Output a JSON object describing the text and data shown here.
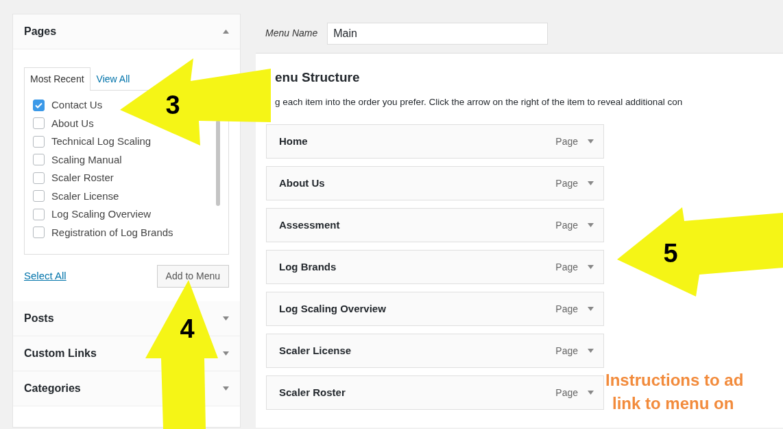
{
  "sidebar": {
    "sections": [
      {
        "title": "Pages",
        "expanded": true,
        "tabs": [
          {
            "label": "Most Recent",
            "selected": true
          },
          {
            "label": "View All",
            "selected": false
          }
        ],
        "items": [
          {
            "label": "Contact Us",
            "checked": true
          },
          {
            "label": "About Us",
            "checked": false
          },
          {
            "label": "Technical Log Scaling",
            "checked": false
          },
          {
            "label": "Scaling Manual",
            "checked": false
          },
          {
            "label": "Scaler Roster",
            "checked": false
          },
          {
            "label": "Scaler License",
            "checked": false
          },
          {
            "label": "Log Scaling Overview",
            "checked": false
          },
          {
            "label": "Registration of Log Brands",
            "checked": false
          }
        ],
        "select_all": "Select All",
        "add_button": "Add to Menu"
      },
      {
        "title": "Posts",
        "expanded": false
      },
      {
        "title": "Custom Links",
        "expanded": false
      },
      {
        "title": "Categories",
        "expanded": false
      }
    ]
  },
  "menu_name": {
    "label": "Menu Name",
    "value": "Main"
  },
  "structure": {
    "heading": "enu Structure",
    "description": "g each item into the order you prefer. Click the arrow on the right of the item to reveal additional con"
  },
  "menu_items": [
    {
      "title": "Home",
      "type": "Page"
    },
    {
      "title": "About Us",
      "type": "Page"
    },
    {
      "title": "Assessment",
      "type": "Page"
    },
    {
      "title": "Log Brands",
      "type": "Page"
    },
    {
      "title": "Log Scaling Overview",
      "type": "Page"
    },
    {
      "title": "Scaler License",
      "type": "Page"
    },
    {
      "title": "Scaler Roster",
      "type": "Page"
    }
  ],
  "annotations": [
    {
      "kind": "arrow",
      "number": "3"
    },
    {
      "kind": "arrow",
      "number": "4"
    },
    {
      "kind": "arrow",
      "number": "5"
    }
  ],
  "caption": [
    "Instructions to ad",
    "link to menu on"
  ]
}
